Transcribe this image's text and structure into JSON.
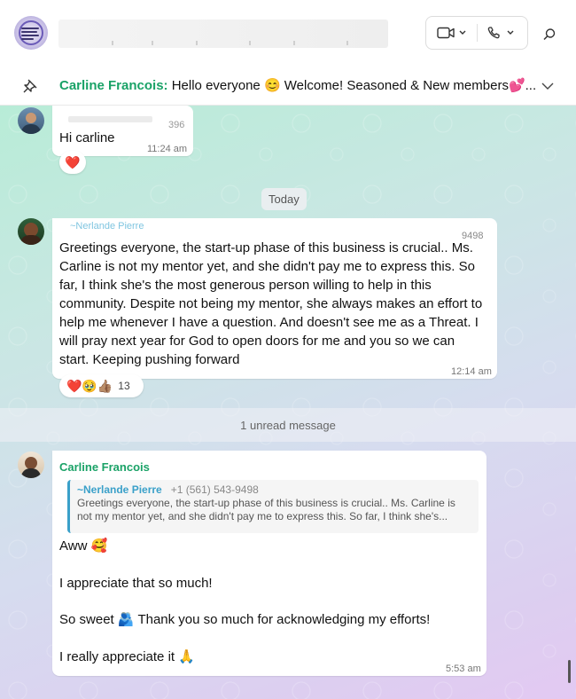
{
  "pinned": {
    "name": "Carline Francois:",
    "text": " Hello everyone 😊  Welcome! Seasoned & New members💕..."
  },
  "messages": [
    {
      "sender_partial": "396",
      "text": "Hi carline",
      "time": "11:24 am",
      "reaction": "❤️"
    },
    {
      "date_divider": "Today"
    },
    {
      "sender": "~Nerlande Pierre",
      "phone_partial": "9498",
      "text": "Greetings everyone, the start-up phase of this business is crucial.. Ms. Carline is not my mentor yet, and she didn't pay me to express this. So far, I think she's the most generous person willing to help in this community. Despite not being my mentor, she always makes an effort to help me whenever I have a question. And doesn't see me as a Threat. I will pray next year for God to open doors for me and you so we can start. Keeping pushing forward",
      "time": "12:14 am",
      "reactions": "❤️🥹👍🏽",
      "reaction_count": "13"
    },
    {
      "unread": "1 unread message"
    },
    {
      "sender": "Carline Francois",
      "quote_name": "~Nerlande Pierre",
      "quote_phone": "+1 (561) 543-9498",
      "quote_text": "Greetings everyone, the start-up phase of this business is crucial.. Ms. Carline is not my mentor yet, and she didn't pay me to express this. So far, I think she's...",
      "lines": [
        "Aww 🥰",
        "I appreciate that so much!",
        "So sweet 🫂 Thank you so much for acknowledging my efforts!",
        "I really appreciate it 🙏"
      ],
      "time": "5:53 am"
    }
  ],
  "icons": [
    "video-icon",
    "chevron-down-icon",
    "phone-icon",
    "search-icon",
    "pin-icon"
  ],
  "colors": {
    "sender_green": "#1aa267",
    "quote_blue": "#3aa0c9"
  }
}
